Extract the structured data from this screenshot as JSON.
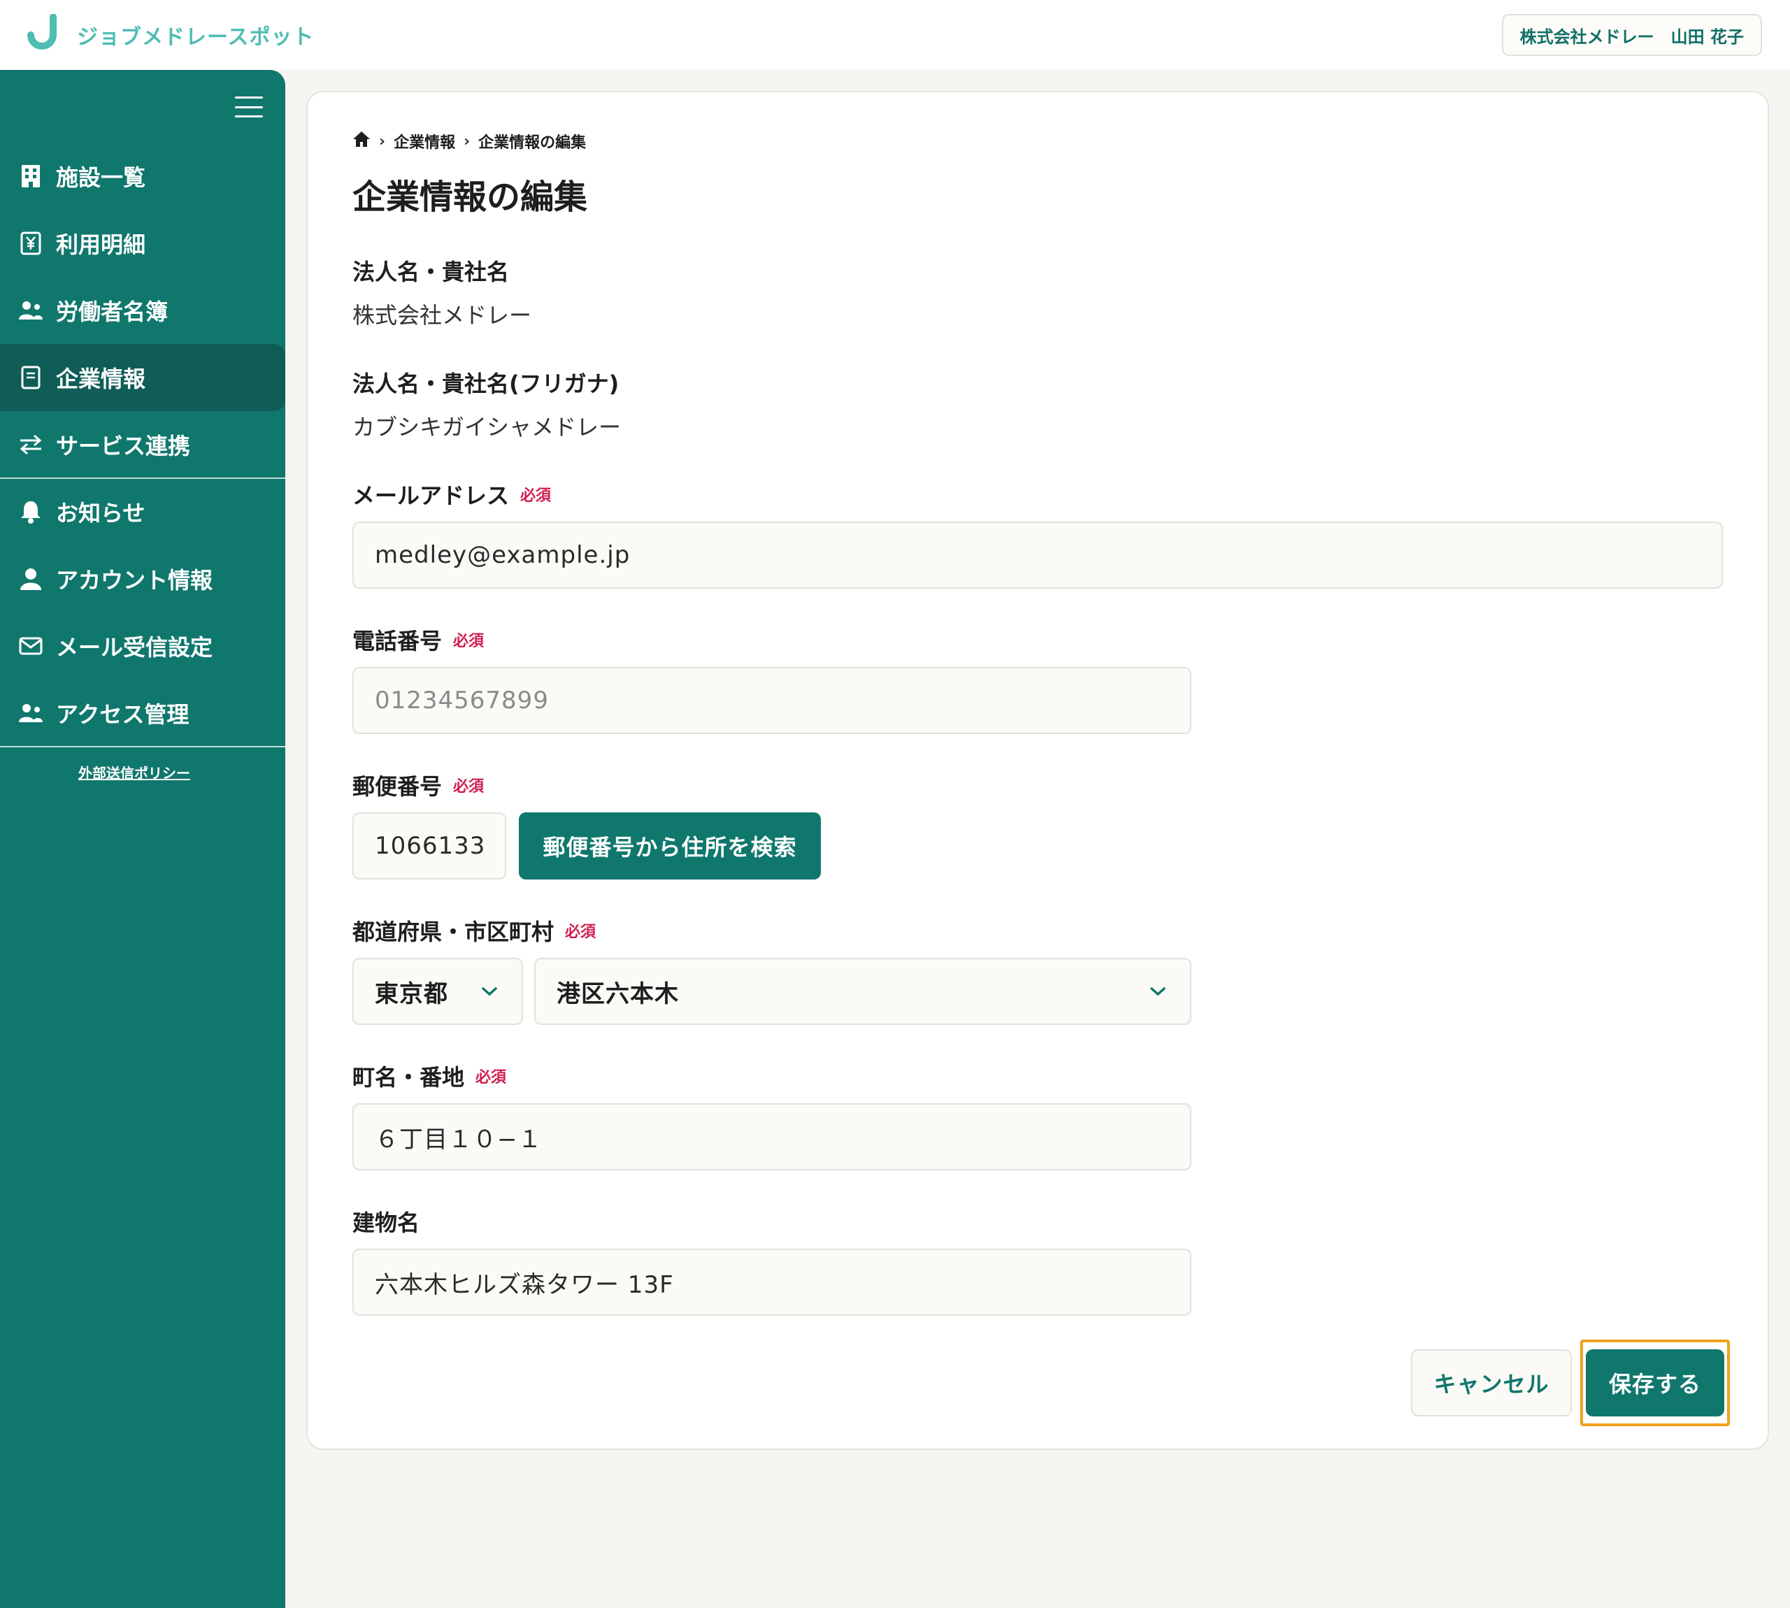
{
  "header": {
    "logo_text": "ジョブメドレースポット",
    "user_label": "株式会社メドレー　山田 花子"
  },
  "sidebar": {
    "items": [
      {
        "label": "施設一覧",
        "icon": "building-icon"
      },
      {
        "label": "利用明細",
        "icon": "yen-receipt-icon"
      },
      {
        "label": "労働者名簿",
        "icon": "users-icon"
      },
      {
        "label": "企業情報",
        "icon": "document-icon",
        "active": true
      },
      {
        "label": "サービス連携",
        "icon": "arrows-swap-icon"
      },
      {
        "label": "お知らせ",
        "icon": "bell-icon"
      },
      {
        "label": "アカウント情報",
        "icon": "person-icon"
      },
      {
        "label": "メール受信設定",
        "icon": "mail-icon"
      },
      {
        "label": "アクセス管理",
        "icon": "users-icon"
      }
    ],
    "policy_link": "外部送信ポリシー"
  },
  "breadcrumb": {
    "items": [
      "企業情報",
      "企業情報の編集"
    ],
    "separator": "›"
  },
  "page": {
    "title": "企業情報の編集"
  },
  "form": {
    "required_badge": "必須",
    "company_name": {
      "label": "法人名・貴社名",
      "value": "株式会社メドレー"
    },
    "company_kana": {
      "label": "法人名・貴社名(フリガナ)",
      "value": "カブシキガイシャメドレー"
    },
    "email": {
      "label": "メールアドレス",
      "value": "medley@example.jp"
    },
    "phone": {
      "label": "電話番号",
      "placeholder": "01234567899"
    },
    "postal": {
      "label": "郵便番号",
      "value": "1066133",
      "search_button": "郵便番号から住所を検索"
    },
    "prefecture_city": {
      "label": "都道府県・市区町村",
      "prefecture": "東京都",
      "city": "港区六本木"
    },
    "street": {
      "label": "町名・番地",
      "value": "６丁目１０−１"
    },
    "building": {
      "label": "建物名",
      "value": "六本木ヒルズ森タワー 13F"
    }
  },
  "actions": {
    "cancel_label": "キャンセル",
    "save_label": "保存する"
  },
  "colors": {
    "brand": "#10776d",
    "brand_dark": "#0f5d56",
    "logo": "#4fbdb1",
    "required": "#d11f4e",
    "focus": "#f0a11e",
    "background": "#f6f5f1"
  }
}
